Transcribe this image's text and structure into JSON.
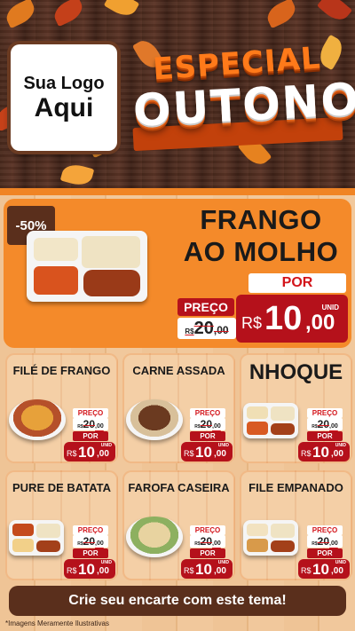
{
  "header": {
    "logo_line1": "Sua Logo",
    "logo_line2": "Aqui",
    "title_top": "ESPECIAL",
    "title_bottom": "OUTONO"
  },
  "featured": {
    "discount": "-50%",
    "name_line1": "FRANGO",
    "name_line2": "AO MOLHO",
    "price_label": "PREÇO",
    "old_price_currency": "R$",
    "old_price_int": "20",
    "old_price_dec": ",00",
    "por_label": "POR",
    "new_price_currency": "R$",
    "new_price_int": "10",
    "new_price_dec": ",00",
    "unit_label": "UNID"
  },
  "products": [
    {
      "name": "FILÉ DE FRANGO",
      "price_label": "PREÇO",
      "old_currency": "R$",
      "old_int": "20",
      "old_dec": ",00",
      "por": "POR",
      "unit": "UNID",
      "currency": "R$",
      "int": "10",
      "dec": ",00"
    },
    {
      "name": "CARNE ASSADA",
      "price_label": "PREÇO",
      "old_currency": "R$",
      "old_int": "20",
      "old_dec": ",00",
      "por": "POR",
      "unit": "UNID",
      "currency": "R$",
      "int": "10",
      "dec": ",00"
    },
    {
      "name": "NHOQUE",
      "price_label": "PREÇO",
      "old_currency": "R$",
      "old_int": "20",
      "old_dec": ",00",
      "por": "POR",
      "unit": "UNID",
      "currency": "R$",
      "int": "10",
      "dec": ",00"
    },
    {
      "name": "PURE DE BATATA",
      "price_label": "PREÇO",
      "old_currency": "R$",
      "old_int": "20",
      "old_dec": ",00",
      "por": "POR",
      "unit": "UNID",
      "currency": "R$",
      "int": "10",
      "dec": ",00"
    },
    {
      "name": "FAROFA CASEIRA",
      "price_label": "PREÇO",
      "old_currency": "R$",
      "old_int": "20",
      "old_dec": ",00",
      "por": "POR",
      "unit": "UNID",
      "currency": "R$",
      "int": "10",
      "dec": ",00"
    },
    {
      "name": "FILE EMPANADO",
      "price_label": "PREÇO",
      "old_currency": "R$",
      "old_int": "20",
      "old_dec": ",00",
      "por": "POR",
      "unit": "UNID",
      "currency": "R$",
      "int": "10",
      "dec": ",00"
    }
  ],
  "footer": {
    "cta": "Crie seu encarte com este tema!",
    "disclaimer": "*Imagens Meramente Ilustrativas"
  },
  "colors": {
    "accent_orange": "#f48a2a",
    "price_red": "#b5111b",
    "dark_brown": "#5a2f1c"
  }
}
